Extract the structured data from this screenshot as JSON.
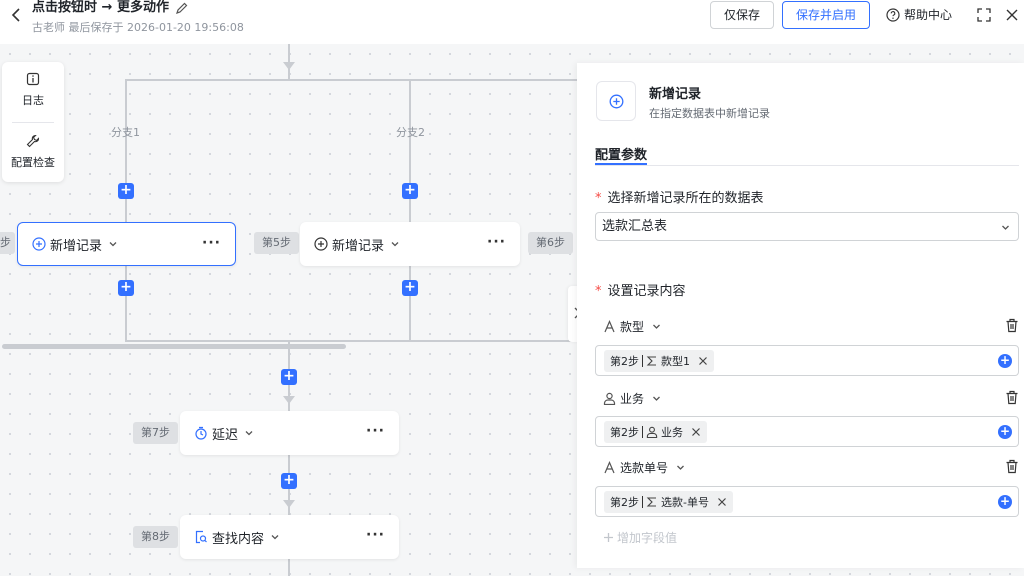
{
  "header": {
    "title": "点击按钮时 → 更多动作",
    "subtitle": "古老师 最后保存于 2026-01-20 19:56:08",
    "save_only": "仅保存",
    "save_enable": "保存并启用",
    "help": "帮助中心"
  },
  "toolbox": {
    "log": "日志",
    "config_check": "配置检查"
  },
  "flow": {
    "branch1": "分支1",
    "branch2": "分支2",
    "steps": {
      "step5": "第5步",
      "step6": "第6步",
      "step7": "第7步",
      "step8": "第8步",
      "partial": "步"
    },
    "nodes": {
      "n1": "新增记录",
      "n2": "新增记录",
      "delay": "延迟",
      "find": "查找内容"
    }
  },
  "panel": {
    "title": "新增记录",
    "desc": "在指定数据表中新增记录",
    "tab": "配置参数",
    "table_label": "选择新增记录所在的数据表",
    "table_value": "选款汇总表",
    "content_label": "设置记录内容",
    "fields": [
      {
        "name": "款型",
        "chip_step": "第2步",
        "chip_value": "款型1",
        "icon": "text-type-icon"
      },
      {
        "name": "业务",
        "chip_step": "第2步",
        "chip_value": "业务",
        "icon": "person-icon"
      },
      {
        "name": "选款单号",
        "chip_step": "第2步",
        "chip_value": "选款-单号",
        "icon": "text-type-icon"
      }
    ],
    "add_field": "增加字段值"
  }
}
